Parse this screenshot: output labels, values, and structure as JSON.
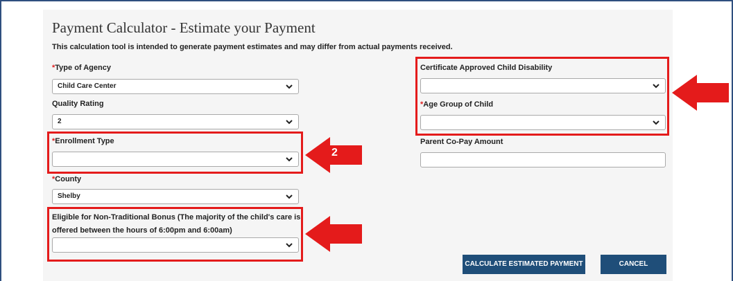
{
  "page": {
    "title": "Payment Calculator - Estimate your Payment",
    "subtitle": "This calculation tool is intended to generate payment estimates and may differ from actual payments received."
  },
  "form": {
    "required_marker": "*",
    "agency_type": {
      "label": "Type of Agency",
      "value": "Child Care Center"
    },
    "quality_rating": {
      "label": "Quality Rating",
      "value": "2"
    },
    "enrollment_type": {
      "label": "Enrollment Type",
      "value": ""
    },
    "county": {
      "label": "County",
      "value": "Shelby"
    },
    "non_traditional": {
      "label_line1": "Eligible for Non-Traditional Bonus (The majority of the child's care is",
      "label_line2": "offered between the hours of 6:00pm and 6:00am)",
      "value": ""
    },
    "child_disability": {
      "label": "Certificate Approved Child Disability",
      "value": ""
    },
    "age_group": {
      "label": "Age Group of Child",
      "value": ""
    },
    "copay": {
      "label": "Parent Co-Pay Amount",
      "value": ""
    }
  },
  "buttons": {
    "calculate": "CALCULATE ESTIMATED PAYMENT",
    "cancel": "CANCEL"
  },
  "annotations": {
    "step_number": "2",
    "highlight_color": "#e41b1b"
  }
}
